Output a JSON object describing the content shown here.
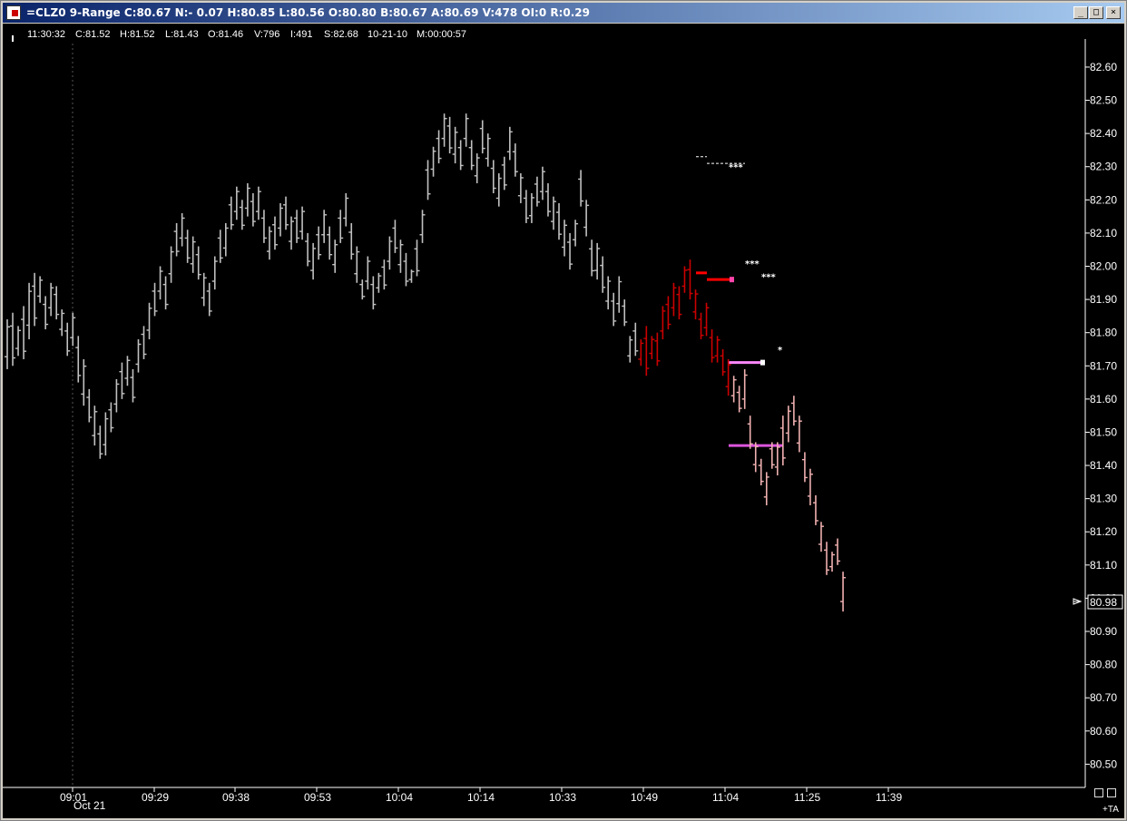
{
  "window": {
    "title": "=CLZ0 9-Range C:80.67 N:- 0.07 H:80.85 L:80.56 O:80.80 B:80.67 A:80.69 V:478 OI:0 R:0.29",
    "buttons": [
      "minimize",
      "maximize",
      "close"
    ]
  },
  "infobar": {
    "time": "11:30:32",
    "close": "C:81.52",
    "high": "H:81.52",
    "low": "L:81.43",
    "open": "O:81.46",
    "volume": "V:796",
    "interest": "I:491",
    "s": "S:82.68",
    "date": "10-21-10",
    "m": "M:00:00:57"
  },
  "chart_data": {
    "type": "bar",
    "title": "",
    "ylabel": "",
    "xlabel": "",
    "ylim": [
      80.43,
      82.66
    ],
    "y_ticks": [
      "82.60",
      "82.50",
      "82.40",
      "82.30",
      "82.20",
      "82.10",
      "82.00",
      "81.90",
      "81.80",
      "81.70",
      "81.60",
      "81.50",
      "81.40",
      "81.30",
      "81.20",
      "81.10",
      "81.00",
      "80.90",
      "80.80",
      "80.70",
      "80.60",
      "80.50"
    ],
    "x_ticks": [
      "09:01",
      "09:29",
      "09:38",
      "09:53",
      "10:04",
      "10:14",
      "10:33",
      "10:49",
      "11:04",
      "11:25",
      "11:39"
    ],
    "x_date_label": "Oct 21",
    "last_price": "80.98",
    "ta_label": "+TA",
    "series": [
      {
        "color": "#c0c0c0",
        "bars": [
          [
            81.84,
            81.69
          ],
          [
            81.86,
            81.7
          ],
          [
            81.82,
            81.73
          ],
          [
            81.88,
            81.72
          ],
          [
            81.95,
            81.78
          ],
          [
            81.98,
            81.82
          ],
          [
            81.97,
            81.89
          ],
          [
            81.91,
            81.81
          ],
          [
            81.95,
            81.85
          ],
          [
            81.94,
            81.84
          ],
          [
            81.87,
            81.79
          ],
          [
            81.83,
            81.73
          ],
          [
            81.86,
            81.76
          ],
          [
            81.79,
            81.65
          ],
          [
            81.72,
            81.58
          ],
          [
            81.63,
            81.53
          ],
          [
            81.58,
            81.46
          ],
          [
            81.52,
            81.42
          ],
          [
            81.56,
            81.43
          ],
          [
            81.59,
            81.5
          ],
          [
            81.66,
            81.56
          ],
          [
            81.71,
            81.6
          ],
          [
            81.73,
            81.64
          ],
          [
            81.69,
            81.59
          ],
          [
            81.78,
            81.68
          ],
          [
            81.82,
            81.72
          ],
          [
            81.89,
            81.78
          ],
          [
            81.95,
            81.85
          ],
          [
            82.0,
            81.9
          ],
          [
            81.97,
            81.87
          ],
          [
            82.06,
            81.95
          ],
          [
            82.13,
            82.03
          ],
          [
            82.16,
            82.06
          ],
          [
            82.11,
            82.01
          ],
          [
            82.09,
            81.98
          ],
          [
            82.06,
            81.96
          ],
          [
            81.98,
            81.88
          ],
          [
            81.95,
            81.85
          ],
          [
            82.03,
            81.93
          ],
          [
            82.11,
            82.01
          ],
          [
            82.13,
            82.03
          ],
          [
            82.21,
            82.11
          ],
          [
            82.24,
            82.14
          ],
          [
            82.2,
            82.11
          ],
          [
            82.25,
            82.15
          ],
          [
            82.22,
            82.12
          ],
          [
            82.24,
            82.14
          ],
          [
            82.17,
            82.07
          ],
          [
            82.12,
            82.02
          ],
          [
            82.15,
            82.05
          ],
          [
            82.19,
            82.09
          ],
          [
            82.21,
            82.11
          ],
          [
            82.15,
            82.05
          ],
          [
            82.17,
            82.07
          ],
          [
            82.18,
            82.08
          ],
          [
            82.1,
            82.0
          ],
          [
            82.07,
            81.96
          ],
          [
            82.12,
            82.02
          ],
          [
            82.17,
            82.07
          ],
          [
            82.12,
            82.02
          ],
          [
            82.08,
            81.98
          ],
          [
            82.17,
            82.07
          ],
          [
            82.22,
            82.12
          ],
          [
            82.13,
            82.02
          ],
          [
            82.06,
            81.95
          ],
          [
            81.96,
            81.9
          ],
          [
            82.03,
            81.93
          ],
          [
            81.97,
            81.87
          ],
          [
            81.98,
            81.92
          ],
          [
            82.02,
            81.93
          ],
          [
            82.09,
            81.99
          ],
          [
            82.14,
            82.04
          ],
          [
            82.08,
            81.98
          ],
          [
            82.04,
            81.94
          ],
          [
            81.99,
            81.95
          ],
          [
            82.08,
            81.97
          ],
          [
            82.17,
            82.07
          ],
          [
            82.32,
            82.2
          ],
          [
            82.36,
            82.27
          ],
          [
            82.41,
            82.31
          ],
          [
            82.46,
            82.36
          ],
          [
            82.45,
            82.34
          ],
          [
            82.42,
            82.31
          ],
          [
            82.38,
            82.29
          ],
          [
            82.46,
            82.36
          ],
          [
            82.38,
            82.29
          ],
          [
            82.34,
            82.25
          ],
          [
            82.44,
            82.34
          ],
          [
            82.4,
            82.3
          ],
          [
            82.32,
            82.22
          ],
          [
            82.28,
            82.18
          ],
          [
            82.33,
            82.23
          ],
          [
            82.42,
            82.32
          ],
          [
            82.37,
            82.27
          ],
          [
            82.28,
            82.19
          ],
          [
            82.23,
            82.13
          ],
          [
            82.22,
            82.13
          ],
          [
            82.27,
            82.18
          ],
          [
            82.3,
            82.2
          ],
          [
            82.25,
            82.15
          ],
          [
            82.21,
            82.11
          ],
          [
            82.19,
            82.08
          ],
          [
            82.14,
            82.03
          ],
          [
            82.1,
            81.99
          ],
          [
            82.14,
            82.06
          ],
          [
            82.29,
            82.18
          ],
          [
            82.2,
            82.09
          ],
          [
            82.08,
            81.97
          ],
          [
            82.07,
            81.96
          ],
          [
            82.03,
            81.92
          ],
          [
            81.97,
            81.87
          ],
          [
            81.92,
            81.82
          ],
          [
            81.97,
            81.86
          ],
          [
            81.9,
            81.82
          ],
          [
            81.79,
            81.71
          ],
          [
            81.83,
            81.73
          ]
        ]
      },
      {
        "color": "#cc0000",
        "bars": [
          [
            81.78,
            81.7
          ],
          [
            81.82,
            81.67
          ],
          [
            81.79,
            81.72
          ],
          [
            81.8,
            81.7
          ],
          [
            81.88,
            81.78
          ],
          [
            81.91,
            81.81
          ],
          [
            81.95,
            81.85
          ],
          [
            81.94,
            81.84
          ],
          [
            82.0,
            81.92
          ],
          [
            82.02,
            81.9
          ],
          [
            81.93,
            81.84
          ],
          [
            81.86,
            81.78
          ],
          [
            81.89,
            81.79
          ],
          [
            81.81,
            81.71
          ],
          [
            81.79,
            81.71
          ],
          [
            81.75,
            81.67
          ],
          [
            81.72,
            81.61
          ]
        ]
      },
      {
        "color": "#f0b0b0",
        "bars": [
          [
            81.67,
            81.59
          ],
          [
            81.64,
            81.56
          ],
          [
            81.69,
            81.57
          ],
          [
            81.55,
            81.45
          ],
          [
            81.47,
            81.38
          ],
          [
            81.42,
            81.34
          ],
          [
            81.38,
            81.28
          ],
          [
            81.47,
            81.39
          ],
          [
            81.47,
            81.37
          ],
          [
            81.55,
            81.4
          ],
          [
            81.58,
            81.47
          ],
          [
            81.61,
            81.52
          ],
          [
            81.55,
            81.44
          ],
          [
            81.44,
            81.35
          ],
          [
            81.39,
            81.28
          ],
          [
            81.31,
            81.22
          ],
          [
            81.23,
            81.14
          ],
          [
            81.17,
            81.07
          ],
          [
            81.14,
            81.08
          ],
          [
            81.18,
            81.1
          ],
          [
            81.08,
            80.96
          ]
        ]
      }
    ],
    "annotations": {
      "star_labels": [
        "***",
        "***",
        "***",
        "*"
      ],
      "levels": [
        {
          "price": 82.33,
          "color": "#ffffff",
          "style": "dash"
        },
        {
          "price": 82.31,
          "color": "#ffffff",
          "style": "dash"
        },
        {
          "price": 81.98,
          "color": "#ff0000",
          "style": "solid"
        },
        {
          "price": 81.96,
          "color": "#ff0000",
          "style": "solid"
        },
        {
          "price": 81.71,
          "color": "#ff88ff",
          "style": "solid"
        },
        {
          "price": 81.46,
          "color": "#dd55dd",
          "style": "solid"
        }
      ]
    }
  }
}
